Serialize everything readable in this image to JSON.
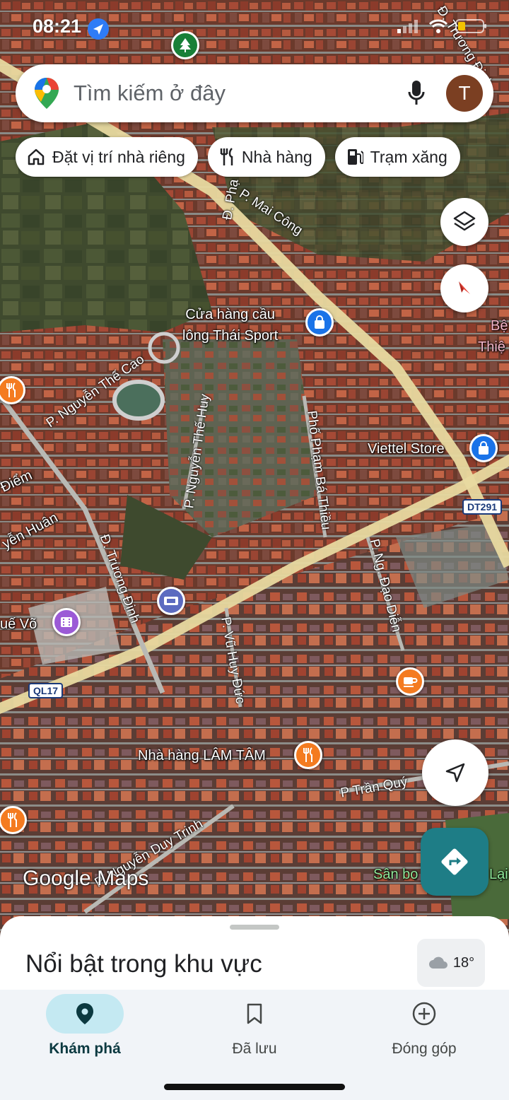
{
  "status_bar": {
    "time": "08:21"
  },
  "search": {
    "placeholder": "Tìm kiếm ở đây",
    "avatar_initial": "T"
  },
  "chips": [
    {
      "label": "Đặt vị trí nhà riêng",
      "icon": "home-icon"
    },
    {
      "label": "Nhà hàng",
      "icon": "restaurant-icon"
    },
    {
      "label": "Trạm xăng",
      "icon": "gas-station-icon"
    }
  ],
  "map": {
    "places": {
      "badminton_shop_line1": "Cửa hàng cầu",
      "badminton_shop_line2": "lông Thái Sport",
      "viettel_store": "Viettel Store",
      "restaurant_lam_tam": "Nhà hàng LÂM TÂM",
      "que_vo": "uế Võ",
      "san_bo": "Sân bo",
      "lai": "Lại",
      "be": "Bệ",
      "thie": "Thiệ",
      "diem": "Điểm",
      "nguyen_huan": "yễn Huân"
    },
    "streets": {
      "mai_cong": "P. Mai Công",
      "pho_ha": "Đ. Phạ",
      "nguyen_the_cao": "P. Nguyễn Thế Cao",
      "nguyen_the_huy": "P. Nguyễn Thế Huy",
      "pham_ba_thieu": "Phố Phạm Bá Thiều",
      "ng_dao_dien": "P. Ng. Đạo Diễn",
      "truong_dinh": "Đ. Trương Định",
      "vu_huy_duc": "P. Vũ Huy Đức",
      "tran_quy": "P Trần Quý",
      "nguyen_duy_trinh": "P. Nguyễn Duy Trinh",
      "truong_dinh_top": "Đ. Trương Định"
    },
    "shields": {
      "dt291": "DT291",
      "ql17": "QL17"
    },
    "brand": "Google Maps"
  },
  "sheet": {
    "title": "Nổi bật trong khu vực",
    "temperature": "18°"
  },
  "nav": [
    {
      "label": "Khám phá",
      "icon": "explore-pin-icon",
      "active": true
    },
    {
      "label": "Đã lưu",
      "icon": "bookmark-icon",
      "active": false
    },
    {
      "label": "Đóng góp",
      "icon": "add-circle-icon",
      "active": false
    }
  ],
  "colors": {
    "teal_accent": "#1e7d86",
    "active_nav_bg": "#c4e9f2",
    "road_yellow": "#e8d9a0"
  }
}
